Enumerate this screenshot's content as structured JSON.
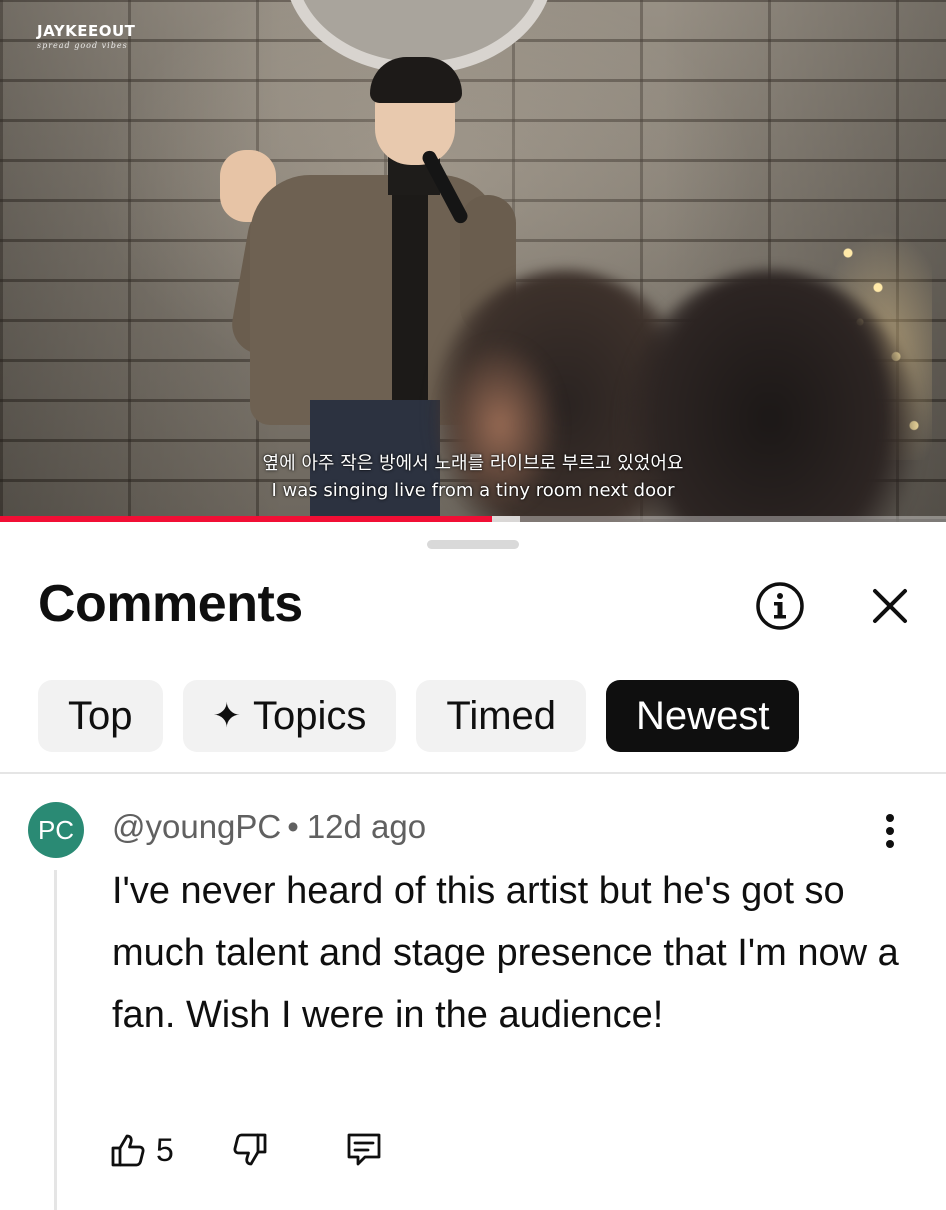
{
  "video": {
    "channel_watermark": "JAYKEEOUT",
    "channel_tagline": "spread good vibes",
    "subtitle_korean": "옆에 아주 작은 방에서 노래를 라이브로 부르고 있었어요",
    "subtitle_english": "I was singing live from a tiny room next door",
    "progress_fraction": 0.52,
    "buffered_fraction": 0.55
  },
  "comments_panel": {
    "title": "Comments",
    "info_icon": "info-circle-icon",
    "close_icon": "close-x-icon",
    "filters": [
      {
        "label": "Top",
        "active": false
      },
      {
        "label": "Topics",
        "active": false,
        "icon": "sparkle-icon"
      },
      {
        "label": "Timed",
        "active": false
      },
      {
        "label": "Newest",
        "active": true
      }
    ]
  },
  "comment": {
    "avatar_initials": "PC",
    "avatar_color": "#2a8a74",
    "author": "@youngPC",
    "separator": "•",
    "age": "12d ago",
    "text": "I've never heard of this artist but he's got so much talent and stage presence that I'm now a fan. Wish I were in the audience!",
    "like_count": "5"
  },
  "colors": {
    "progress": "#f10f35",
    "chip_active_bg": "#0f0f0f",
    "chip_bg": "#f2f2f2",
    "meta_text": "#606060"
  }
}
